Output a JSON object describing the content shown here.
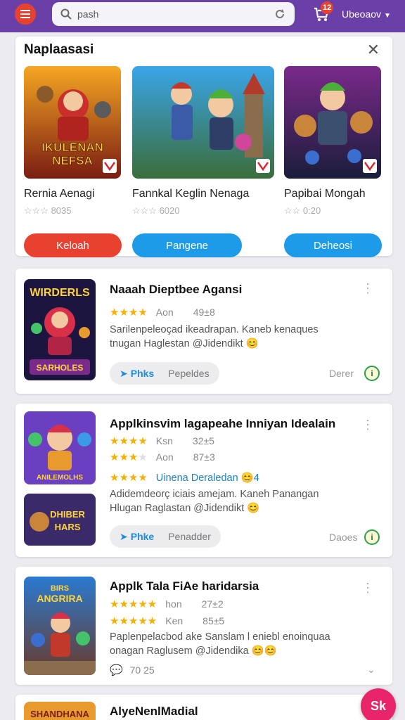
{
  "colors": {
    "brand": "#6a3fa8",
    "accent": "#e8412f",
    "link": "#1d8de0",
    "star": "#f4b000"
  },
  "topbar": {
    "menu_icon": "hamburger-icon",
    "search_value": "pash",
    "search_icon": "search-icon",
    "refresh_icon": "refresh-icon",
    "cart_icon": "cart-icon",
    "cart_badge": "12",
    "user_label": "Ubeoaov"
  },
  "featured": {
    "title": "Naplaasasi",
    "close_icon": "close-icon",
    "items": [
      {
        "name": "Rernia Aenagi",
        "rating": "☆☆☆ 8035",
        "art_text": "IKULENAN NEFSA",
        "button": "Keloah",
        "button_color": "#e8412f"
      },
      {
        "name": "Fannkal Keglin Nenaga",
        "rating": "☆☆☆ 6020",
        "art_text": "",
        "button": "Pangene",
        "button_color": "#1d9be8"
      },
      {
        "name": "Papibai Mongah",
        "rating": "☆☆ 0:20",
        "art_text": "",
        "button": "Deheosi",
        "button_color": "#1d9be8"
      }
    ]
  },
  "apps": [
    {
      "title": "Naaah Dieptbee Agansi",
      "thumb_text": "WIRDERLS",
      "thumb_sub": "SARHOLES",
      "ratings": [
        {
          "label": "Aon",
          "num": "49±8",
          "stars": 4
        }
      ],
      "desc_lines": [
        "Sarilenpeleoçad ikeadrapan. Kaneb kenaques",
        "tnugan Haglestan @Jidendikt 😊"
      ],
      "tag_a": "Phks",
      "tag_b": "Pepeldes",
      "side_label": "Derer",
      "side_icon": "info-icon"
    },
    {
      "title": "Applkinsvim lagapeahe Inniyan Idealain",
      "thumb_text": "ANILEMOLHS",
      "thumb2_text": "DHIBER HARS",
      "ratings": [
        {
          "label": "Ksn",
          "num": "32±5",
          "stars": 4
        },
        {
          "label": "Aon",
          "num": "87±3",
          "stars": 3
        }
      ],
      "highlight": "Uinena Deraledan 😊4",
      "desc_lines": [
        "Adidemdeorç iciais amejam. Kaneh Panangan",
        "Hlugan Raglastan @Jidendikt 😊"
      ],
      "tag_a": "Phke",
      "tag_b": "Penadder",
      "side_label": "Daoes",
      "side_icon": "info-icon"
    },
    {
      "title": "Applk Tala FiAe haridarsia",
      "thumb_text": "BIRS ANGRIRA",
      "ratings": [
        {
          "label": "hon",
          "num": "27±2",
          "stars": 5
        },
        {
          "label": "Ken",
          "num": "85±5",
          "stars": 5
        }
      ],
      "desc_lines": [
        "Paplenpelacbod ake Sanslam l eniebl enoinquaa",
        "onagan Raglusem @Jidendika 😊😊"
      ],
      "comment_icon": "comment-icon",
      "comment_count": "70 25",
      "expand_icon": "chevron-down-icon"
    },
    {
      "title": "AlyeNenlMadial",
      "thumb_text": "SHANDHANA"
    }
  ],
  "fab_label": "Sk"
}
